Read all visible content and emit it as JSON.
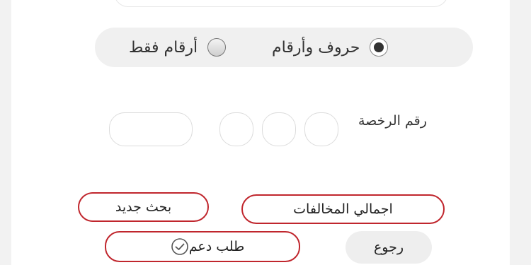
{
  "plate_type": {
    "options": [
      {
        "label": "حروف وأرقام",
        "selected": true
      },
      {
        "label": "أرقام فقط",
        "selected": false
      }
    ]
  },
  "plate": {
    "label": "رقم الرخصة"
  },
  "buttons": {
    "total_violations": "اجمالي المخالفات",
    "new_search": "بحث جديد",
    "support_request": "طلب دعم",
    "back": "رجوع"
  },
  "colors": {
    "accent": "#c0262d"
  }
}
